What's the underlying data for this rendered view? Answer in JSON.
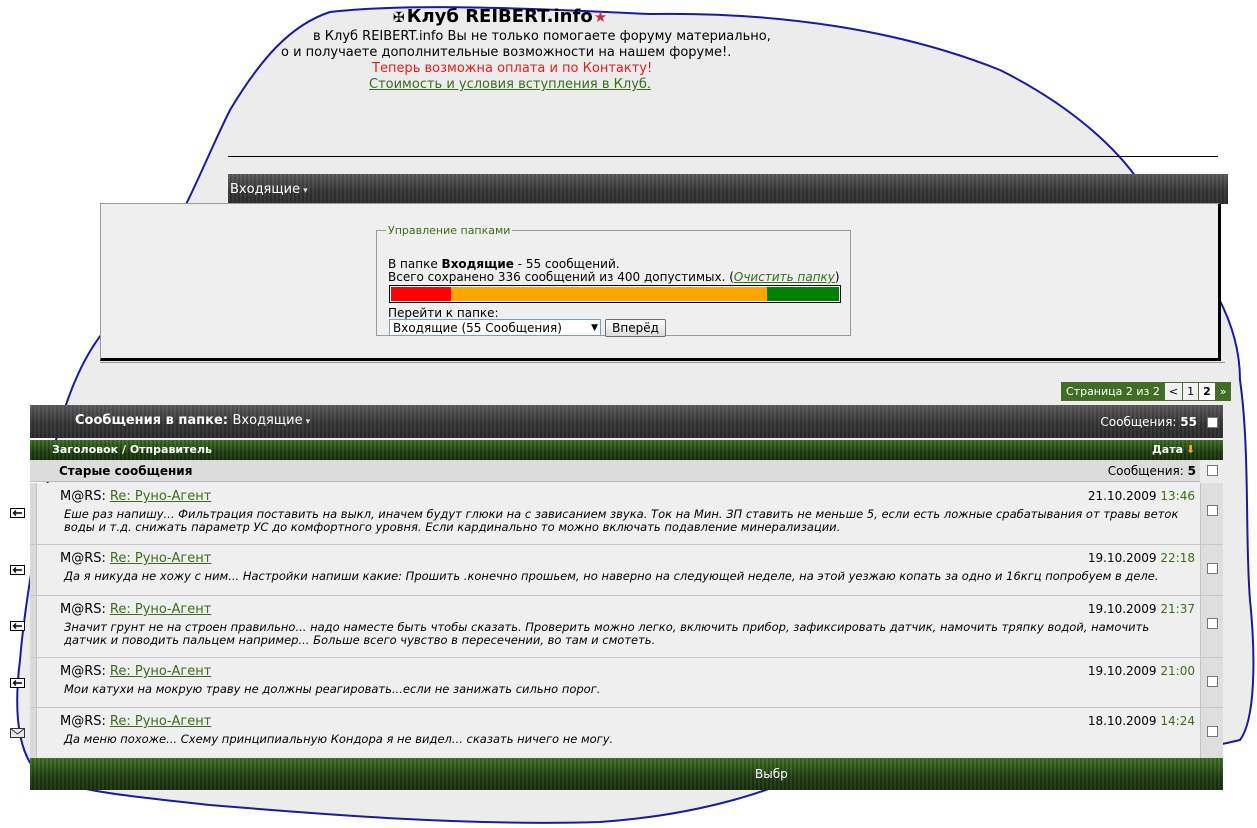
{
  "header": {
    "site_title": "Клуб REIBERT.info",
    "line1": "в Клуб REIBERT.info Вы не только помогаете форуму материально,",
    "line2": "о и получаете дополнительные возможности на нашем форуме!.",
    "notice": "Теперь возможна оплата и по Контакту!",
    "link": "Стоимость и условия вступления в Клуб."
  },
  "nav": {
    "folder_label": "Входящие"
  },
  "folder_panel": {
    "legend": "Управление папками",
    "in_folder_prefix": "В папке ",
    "folder_name": "Входящие",
    "in_folder_suffix": " - 55 сообщений.",
    "storage_text": "Всего сохранено 336 сообщений из 400 допустимых. (",
    "clear_link": "Очистить папку",
    "storage_close": ")",
    "usage_fraction": 0.84,
    "usage_colors": [
      "#ff0000",
      "#ffa500",
      "#008000"
    ],
    "goto_label": "Перейти к папке:",
    "select_value": "Входящие (55 Сообщения)",
    "go_button": "Вперёд"
  },
  "pager": {
    "info": "Страница 2 из 2",
    "prev": "<",
    "page1": "1",
    "current": "2",
    "jump": "»"
  },
  "list": {
    "title": "Сообщения в папке:",
    "folder": "Входящие",
    "count_label": "Сообщения:",
    "count": "55",
    "col_title": "Заголовок / Отправитель",
    "col_date": "Дата",
    "group_title": "Старые сообщения",
    "group_count_label": "Сообщения:",
    "group_count": "5",
    "footer_label": "Выбр"
  },
  "messages": [
    {
      "sender": "M@RS:",
      "subject": "Re: Руно-Агент",
      "date": "21.10.2009",
      "time": "13:46",
      "preview": "Еше раз напишу... Фильтрация поставить на выкл, иначем будут глюки на с зависанием звука. Ток на Мин. ЗП ставить не меньше 5, если есть ложные срабатывания от травы веток воды и т.д. снижать параметр УС до комфортного уровня. Если кардинально то можно включать подавление минерализации.",
      "status_icon": "replied-icon"
    },
    {
      "sender": "M@RS:",
      "subject": "Re: Руно-Агент",
      "date": "19.10.2009",
      "time": "22:18",
      "preview": "Да я никуда не хожу с ним... Настройки напиши какие: Прошить .конечно прошьем, но наверно на следующей неделе, на этой уезжаю копать за одно и 16кгц попробуем в деле.",
      "status_icon": "replied-icon"
    },
    {
      "sender": "M@RS:",
      "subject": "Re: Руно-Агент",
      "date": "19.10.2009",
      "time": "21:37",
      "preview": "Значит грунт не на строен правильно... надо наместе быть чтобы сказать. Проверить можно легко, включить прибор, зафиксировать датчик, намочить тряпку водой, намочить датчик и поводить пальцем например... Больше всего чувство в пересечении, во там и смотеть.",
      "status_icon": "replied-icon"
    },
    {
      "sender": "M@RS:",
      "subject": "Re: Руно-Агент",
      "date": "19.10.2009",
      "time": "21:00",
      "preview": "Мои катухи на мокрую траву не должны реагировать...если не занижать сильно порог.",
      "status_icon": "replied-icon"
    },
    {
      "sender": "M@RS:",
      "subject": "Re: Руно-Агент",
      "date": "18.10.2009",
      "time": "14:24",
      "preview": "Да меню похоже... Схему принципиальную Кондора я не видел... сказать ничего не могу.",
      "status_icon": "read-envelope-icon"
    }
  ]
}
